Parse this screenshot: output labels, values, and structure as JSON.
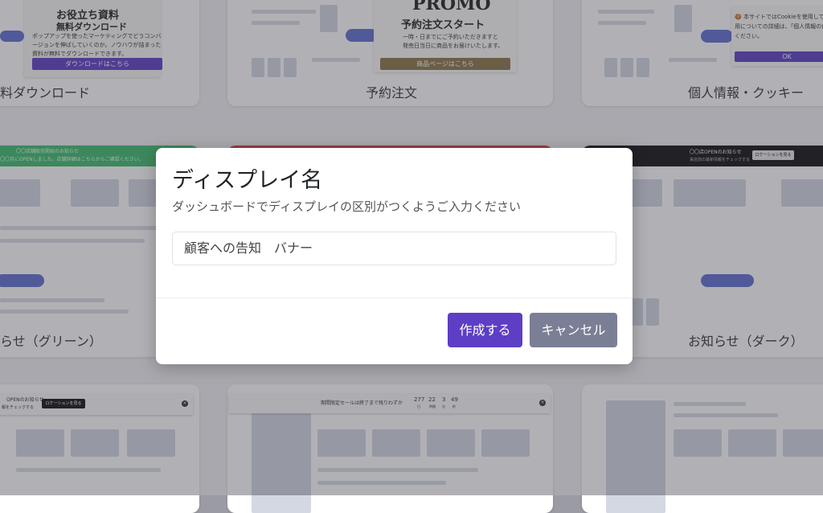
{
  "background_cards": {
    "download": {
      "title": "お役立ち資料",
      "subtitle": "無料ダウンロード",
      "text_lines": [
        "ポップアップを使ったマーケティングでどうコンバ",
        "ージョンを伸ばしていくのか。ノウハウが詰まった",
        "資料が無料でダウンロードできます。"
      ],
      "button_label": "ダウンロードはこちら",
      "caption": "料ダウンロード"
    },
    "reservation": {
      "promo": "PROMO",
      "title": "予約注文スタート",
      "text_lines": [
        "一時・日までにご予約いただきますと",
        "発売日当日に商品をお届けいたします。"
      ],
      "button_label": "商品ページはこちら",
      "caption": "予約注文"
    },
    "privacy": {
      "text_lines": [
        "🍪 本サイトではCookieを使用していま",
        "用についての詳細は、「個人情報の保護",
        "ください。"
      ],
      "button_label": "OK",
      "caption": "個人情報・クッキー"
    },
    "green_notice": {
      "text_lines": [
        "〇〇店舗販売開始のお知らせ",
        "〇〇月にOPENしました。店舗詳細はこちらからご確認ください。"
      ],
      "caption": "らせ（グリーン）"
    },
    "dark_notice": {
      "title": "〇〇店OPENのお知らせ",
      "sub": "来店前の最新情報をチェックする",
      "button_label": "ロケーションを見る",
      "caption": "お知らせ（ダーク）"
    },
    "bottom_left": {
      "title": "OPENのお知らせ",
      "sub": "報をチェックする",
      "button_label": "ロケーションを見る"
    },
    "bottom_mid": {
      "text": "期間限定セールは終了まで残りわずか",
      "countdown": [
        {
          "value": "277",
          "unit": "日"
        },
        {
          "value": "22",
          "unit": "時間"
        },
        {
          "value": "3",
          "unit": "分"
        },
        {
          "value": "49",
          "unit": "秒"
        }
      ]
    }
  },
  "modal": {
    "title": "ディスプレイ名",
    "description": "ダッシュボードでディスプレイの区別がつくようご入力ください",
    "input_value": "顧客への告知　バナー",
    "create_label": "作成する",
    "cancel_label": "キャンセル"
  },
  "colors": {
    "primary": "#5d3ec5",
    "secondary": "#7b7f96",
    "green": "#3dbb6c",
    "red": "#d93a3a",
    "dark": "#111111"
  }
}
